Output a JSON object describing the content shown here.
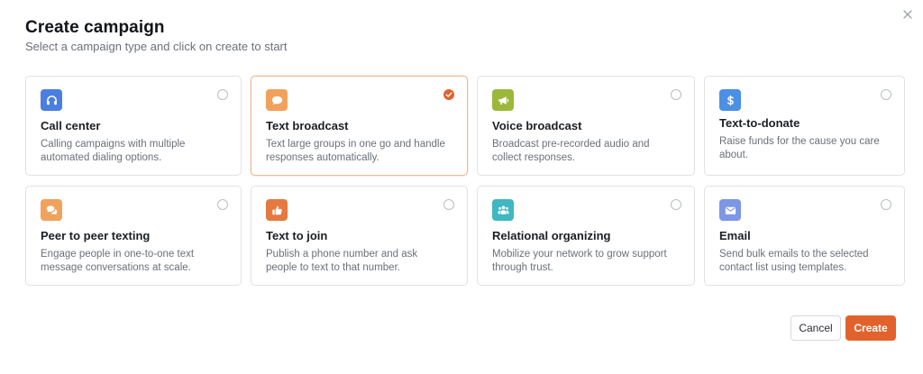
{
  "dialog": {
    "title": "Create campaign",
    "subtitle": "Select a campaign type and click on create to start"
  },
  "icons": {
    "close": "close-icon"
  },
  "colors": {
    "accent": "#e2622c",
    "selected_border": "#f0b896"
  },
  "campaign_types": [
    {
      "name": "Call center",
      "description": "Calling campaigns with multiple automated dialing options.",
      "icon": "headset-icon",
      "icon_color": "#4a7fe0",
      "selected": false
    },
    {
      "name": "Text broadcast",
      "description": "Text large groups in one go and handle responses automatically.",
      "icon": "chat-bubble-icon",
      "icon_color": "#f0a25c",
      "selected": true
    },
    {
      "name": "Voice broadcast",
      "description": "Broadcast pre-recorded audio and collect responses.",
      "icon": "megaphone-icon",
      "icon_color": "#9cb83a",
      "selected": false
    },
    {
      "name": "Text-to-donate",
      "description": "Raise funds for the cause you care about.",
      "icon": "dollar-icon",
      "icon_color": "#4b8fe6",
      "selected": false
    },
    {
      "name": "Peer to peer texting",
      "description": "Engage people in one-to-one text message conversations at scale.",
      "icon": "conversation-icon",
      "icon_color": "#f0a25c",
      "selected": false
    },
    {
      "name": "Text to join",
      "description": "Publish a phone number and ask people to text to that number.",
      "icon": "thumbs-up-icon",
      "icon_color": "#e5793f",
      "selected": false
    },
    {
      "name": "Relational organizing",
      "description": "Mobilize your network to grow support through trust.",
      "icon": "people-icon",
      "icon_color": "#3fb8c0",
      "selected": false
    },
    {
      "name": "Email",
      "description": "Send bulk emails to the selected contact list using templates.",
      "icon": "envelope-icon",
      "icon_color": "#7d97e6",
      "selected": false
    }
  ],
  "footer": {
    "cancel_label": "Cancel",
    "create_label": "Create"
  }
}
